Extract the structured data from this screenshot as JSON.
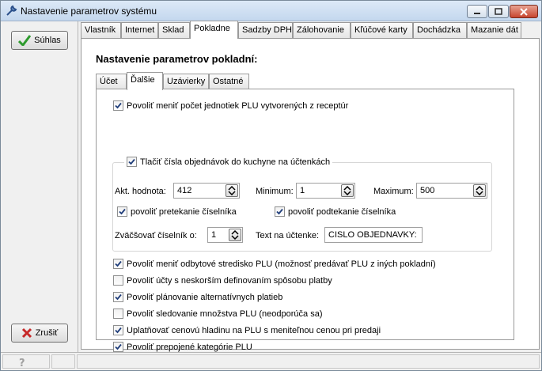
{
  "window": {
    "title": "Nastavenie parametrov systému"
  },
  "left": {
    "confirm_label": "Súhlas",
    "cancel_label": "Zrušiť"
  },
  "tabs": [
    "Vlastník",
    "Internet",
    "Sklad",
    "Pokladne",
    "Sadzby DPH",
    "Zálohovanie",
    "Kľúčové karty",
    "Dochádzka",
    "Mazanie dát"
  ],
  "active_tab": "Pokladne",
  "page": {
    "title": "Nastavenie parametrov pokladní:",
    "sub_tabs": [
      "Účet",
      "Ďalšie",
      "Uzávierky",
      "Ostatné"
    ],
    "active_sub_tab": "Ďalšie"
  },
  "options": {
    "change_qty": {
      "label": "Povoliť meniť počet jednotiek PLU vytvorených z receptúr",
      "checked": true
    },
    "print_order_numbers": {
      "label": "Tlačiť čísla objednávok do kuchyne na účtenkách",
      "checked": true
    },
    "current_value_label": "Akt. hodnota:",
    "current_value": "412",
    "minimum_label": "Minimum:",
    "minimum": "1",
    "maximum_label": "Maximum:",
    "maximum": "500",
    "allow_overflow": {
      "label": "povoliť pretekanie číselníka",
      "checked": true
    },
    "allow_underflow": {
      "label": "povoliť podtekanie číselníka",
      "checked": true
    },
    "increment_label": "Zväčšovať číselník o:",
    "increment": "1",
    "receipt_text_label": "Text na účtenke:",
    "receipt_text": "CISLO OBJEDNAVKY:",
    "change_sales_center": {
      "label": "Povoliť meniť odbytové stredisko PLU (možnosť predávať PLU z iných pokladní)",
      "checked": true
    },
    "later_payment": {
      "label": "Povoliť účty s neskorším definovaním spôsobu platby",
      "checked": false
    },
    "alt_payments": {
      "label": "Povoliť plánovanie alternatívnych platieb",
      "checked": true
    },
    "track_qty": {
      "label": "Povoliť sledovanie množstva PLU (neodporúča sa)",
      "checked": false
    },
    "apply_price_level": {
      "label": "Uplatňovať cenovú hladinu na PLU s meniteľnou cenou pri predaji",
      "checked": true
    },
    "linked_categories": {
      "label": "Povoliť prepojené kategórie PLU",
      "checked": true
    }
  },
  "colors": {
    "check": "#1f3d7a",
    "ok_icon": "#2e9b2e",
    "cancel_icon": "#c62828"
  }
}
